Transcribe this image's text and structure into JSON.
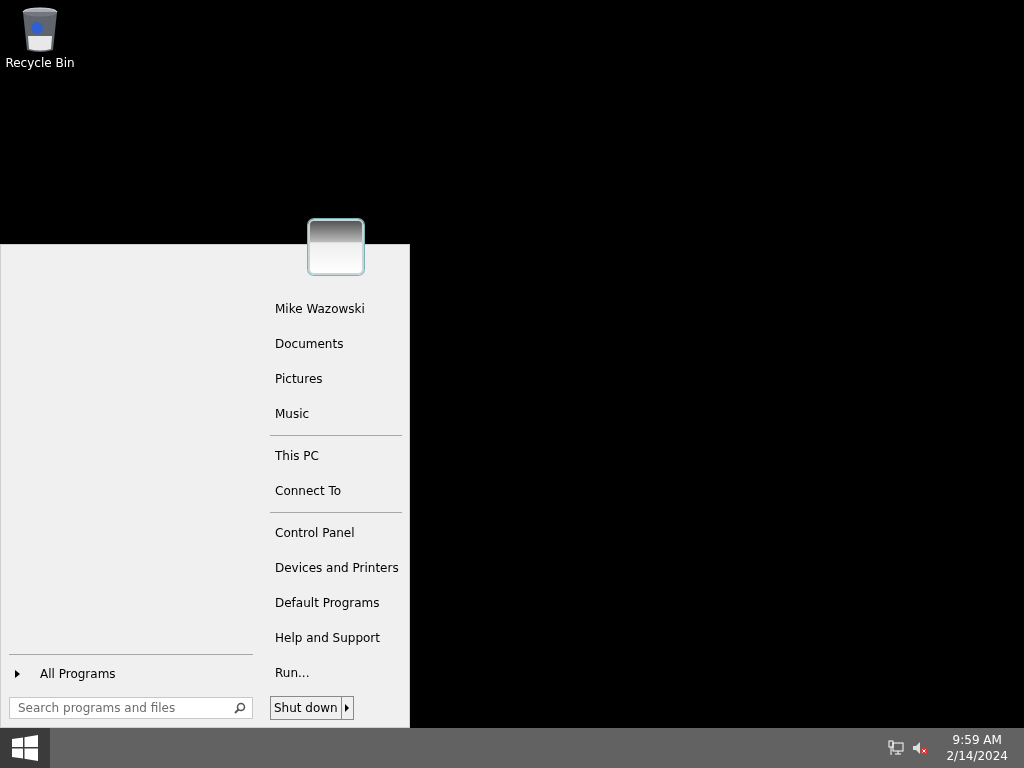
{
  "desktop_icons": [
    {
      "label": "Recycle Bin"
    }
  ],
  "start_menu": {
    "all_programs": "All Programs",
    "search": {
      "placeholder": "Search programs and files"
    },
    "right_groups": [
      [
        "Mike Wazowski",
        "Documents",
        "Pictures",
        "Music"
      ],
      [
        "This PC",
        "Connect To"
      ],
      [
        "Control Panel",
        "Devices and Printers",
        "Default Programs",
        "Help and Support",
        "Run..."
      ]
    ],
    "shutdown": "Shut down"
  },
  "taskbar": {
    "time": "9:59 AM",
    "date": "2/14/2024"
  }
}
